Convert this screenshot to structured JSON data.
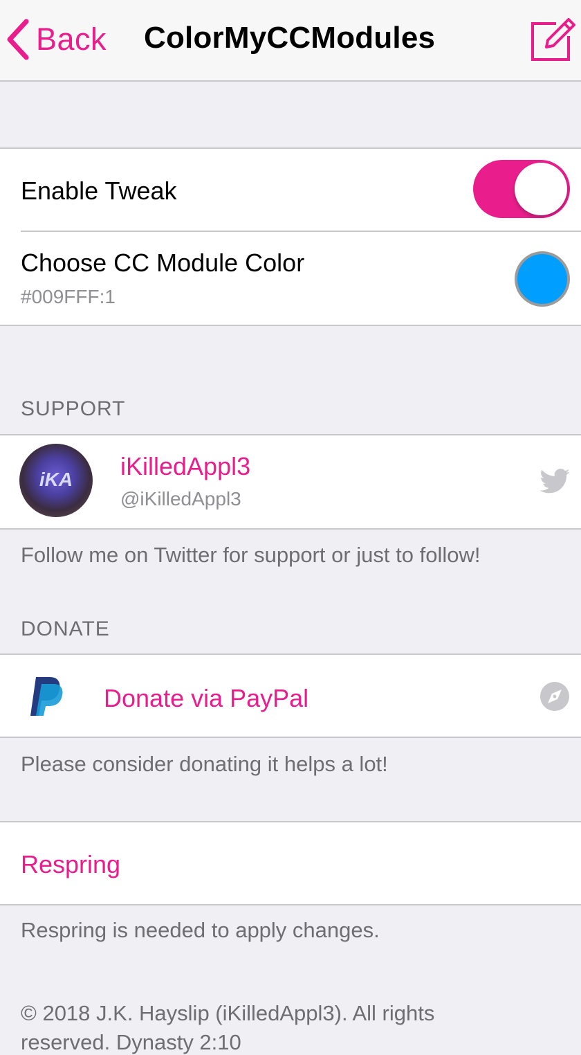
{
  "colors": {
    "accent": "#e91e8c",
    "swatch": "#009fff",
    "paypal_dark": "#253b80",
    "paypal_light": "#179bd7",
    "secondary_icon": "#c7c7cc"
  },
  "navbar": {
    "back_label": "Back",
    "title": "ColorMyCCModules",
    "compose_icon": "compose-icon"
  },
  "settings": {
    "enable_tweak": {
      "label": "Enable Tweak",
      "value": true
    },
    "color_picker": {
      "label": "Choose CC Module Color",
      "value": "#009FFF:1"
    }
  },
  "support": {
    "header": "SUPPORT",
    "avatar_text": "iKA",
    "name": "iKilledAppl3",
    "handle": "@iKilledAppl3",
    "icon": "twitter-icon",
    "footer": "Follow me on Twitter for support or just to follow!"
  },
  "donate": {
    "header": "DONATE",
    "icon": "paypal-icon",
    "label": "Donate via PayPal",
    "trailing_icon": "compass-icon",
    "footer": "Please consider donating it helps a lot!"
  },
  "respring": {
    "label": "Respring",
    "footer": "Respring is needed to apply changes."
  },
  "copyright": {
    "line1": "© 2018 J.K. Hayslip (iKilledAppl3). All rights",
    "line2": "reserved. Dynasty 2:10"
  }
}
